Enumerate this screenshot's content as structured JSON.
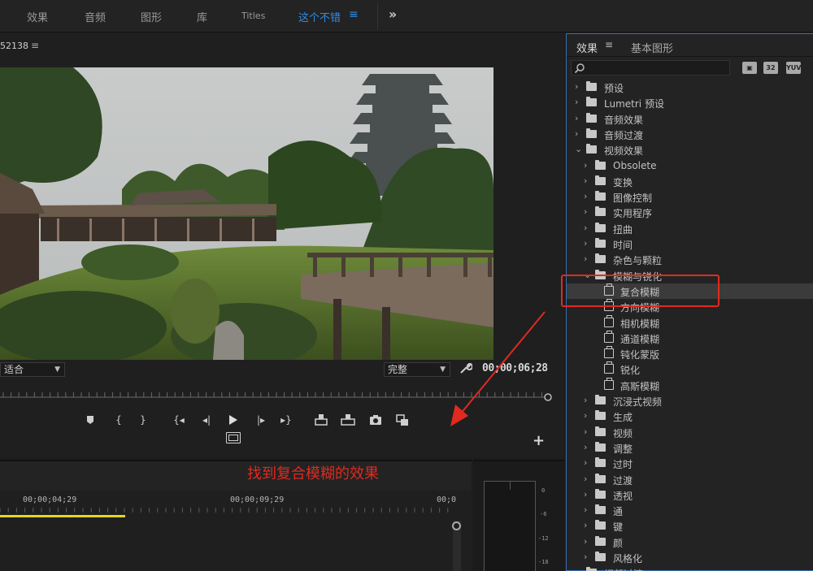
{
  "workspace": {
    "tabs": [
      {
        "label": "效果",
        "active": false
      },
      {
        "label": "音频",
        "active": false
      },
      {
        "label": "图形",
        "active": false
      },
      {
        "label": "库",
        "active": false
      },
      {
        "label": "Titles",
        "active": false
      },
      {
        "label": "这个不错",
        "active": true
      }
    ],
    "menu_icon": "hamburger-icon",
    "more_icon": "double-chevron-right-icon"
  },
  "monitor": {
    "title": "52138",
    "fit": "适合",
    "quality": "完整",
    "timecode": "00;00;06;28"
  },
  "timeline": {
    "labels": [
      "00;00;04;29",
      "00;00;09;29",
      "00;0"
    ]
  },
  "meter": {
    "labels": [
      "0",
      "-6",
      "-12",
      "-18"
    ]
  },
  "annotation": "找到复合模糊的效果",
  "effects": {
    "tab_effects": "效果",
    "tab_graphics": "基本图形",
    "badges": [
      "32",
      "YUV"
    ],
    "tree": [
      {
        "label": "预设",
        "depth": 0,
        "expanded": false,
        "type": "preset-folder"
      },
      {
        "label": "Lumetri 预设",
        "depth": 0,
        "expanded": false,
        "type": "preset-folder"
      },
      {
        "label": "音频效果",
        "depth": 0,
        "expanded": false,
        "type": "folder"
      },
      {
        "label": "音频过渡",
        "depth": 0,
        "expanded": false,
        "type": "folder"
      },
      {
        "label": "视频效果",
        "depth": 0,
        "expanded": true,
        "type": "folder"
      },
      {
        "label": "Obsolete",
        "depth": 1,
        "expanded": false,
        "type": "folder"
      },
      {
        "label": "变换",
        "depth": 1,
        "expanded": false,
        "type": "folder"
      },
      {
        "label": "图像控制",
        "depth": 1,
        "expanded": false,
        "type": "folder"
      },
      {
        "label": "实用程序",
        "depth": 1,
        "expanded": false,
        "type": "folder"
      },
      {
        "label": "扭曲",
        "depth": 1,
        "expanded": false,
        "type": "folder"
      },
      {
        "label": "时间",
        "depth": 1,
        "expanded": false,
        "type": "folder"
      },
      {
        "label": "杂色与颗粒",
        "depth": 1,
        "expanded": false,
        "type": "folder"
      },
      {
        "label": "模糊与锐化",
        "depth": 1,
        "expanded": true,
        "type": "folder"
      },
      {
        "label": "复合模糊",
        "depth": 2,
        "type": "effect",
        "selected": true
      },
      {
        "label": "方向模糊",
        "depth": 2,
        "type": "effect"
      },
      {
        "label": "相机模糊",
        "depth": 2,
        "type": "effect"
      },
      {
        "label": "通道模糊",
        "depth": 2,
        "type": "effect"
      },
      {
        "label": "钝化蒙版",
        "depth": 2,
        "type": "effect"
      },
      {
        "label": "锐化",
        "depth": 2,
        "type": "effect"
      },
      {
        "label": "高斯模糊",
        "depth": 2,
        "type": "effect"
      },
      {
        "label": "沉浸式视频",
        "depth": 1,
        "expanded": false,
        "type": "folder"
      },
      {
        "label": "生成",
        "depth": 1,
        "expanded": false,
        "type": "folder"
      },
      {
        "label": "视频",
        "depth": 1,
        "expanded": false,
        "type": "folder"
      },
      {
        "label": "调整",
        "depth": 1,
        "expanded": false,
        "type": "folder"
      },
      {
        "label": "过时",
        "depth": 1,
        "expanded": false,
        "type": "folder"
      },
      {
        "label": "过渡",
        "depth": 1,
        "expanded": false,
        "type": "folder"
      },
      {
        "label": "透视",
        "depth": 1,
        "expanded": false,
        "type": "folder"
      },
      {
        "label": "通",
        "depth": 1,
        "expanded": false,
        "type": "folder"
      },
      {
        "label": "键",
        "depth": 1,
        "expanded": false,
        "type": "folder"
      },
      {
        "label": "颜",
        "depth": 1,
        "expanded": false,
        "type": "folder"
      },
      {
        "label": "风格化",
        "depth": 1,
        "expanded": false,
        "type": "folder"
      },
      {
        "label": "视频过渡",
        "depth": 0,
        "expanded": false,
        "type": "folder"
      }
    ]
  }
}
